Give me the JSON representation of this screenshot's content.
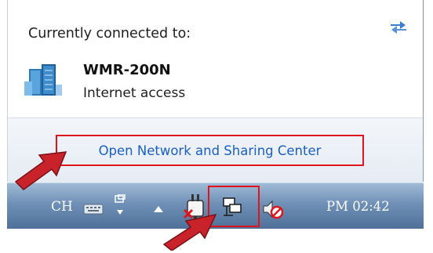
{
  "popup": {
    "connected_label": "Currently connected to:",
    "network_name": "WMR-200N",
    "network_status": "Internet access",
    "open_center_link": "Open Network and Sharing Center",
    "refresh_icon": "refresh-arrows-icon",
    "network_icon": "network-buildings-icon"
  },
  "taskbar": {
    "language": "CH",
    "clock": "PM 02:42",
    "icons": [
      "keyboard-icon",
      "ime-options-icon",
      "show-hidden-icons-icon",
      "power-plug-icon",
      "network-tray-icon",
      "volume-muted-icon"
    ]
  },
  "annotations": {
    "highlight_color": "#e0141c",
    "arrow_color": "#c8222a"
  },
  "colors": {
    "link": "#1a5fc4",
    "taskbar_top": "#9fbad6",
    "taskbar_bottom": "#4f6f98"
  }
}
